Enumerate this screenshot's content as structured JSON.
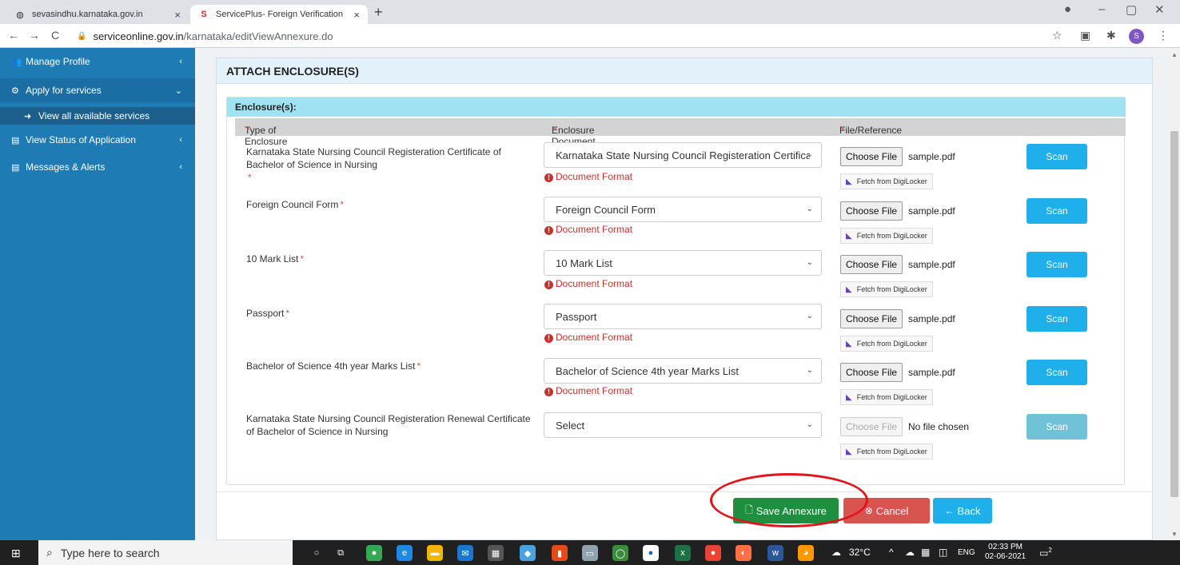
{
  "browser": {
    "tabs": [
      {
        "label": "sevasindhu.karnataka.gov.in"
      },
      {
        "label": "ServicePlus- Foreign Verification"
      }
    ],
    "url_host": "serviceonline.gov.in",
    "url_path": "/karnataka/editViewAnnexure.do",
    "profile_initial": "S"
  },
  "sidebar": {
    "items": [
      {
        "label": "Manage Profile"
      },
      {
        "label": "Apply for services"
      },
      {
        "label": "View all available services"
      },
      {
        "label": "View Status of Application"
      },
      {
        "label": "Messages & Alerts"
      }
    ]
  },
  "card": {
    "title": "ATTACH ENCLOSURE(S)",
    "panel_title": "Enclosure(s):",
    "columns": [
      "Type of Enclosure",
      "Enclosure Document",
      "File/Reference"
    ],
    "doc_format_label": "Document Format",
    "choose_file_label": "Choose File",
    "digilocker_label": "Fetch from DigiLocker",
    "scan_label": "Scan",
    "rows": [
      {
        "type": "Karnataka State Nursing Council Registeration Certificate of Bachelor of Science in Nursing",
        "document": "Karnataka State Nursing Council Registeration Certificate of Bachelor of Science in Nursing",
        "file": "sample.pdf"
      },
      {
        "type": "Foreign Council Form",
        "document": "Foreign Council Form",
        "file": "sample.pdf"
      },
      {
        "type": "10 Mark List",
        "document": "10 Mark List",
        "file": "sample.pdf"
      },
      {
        "type": "Passport",
        "document": "Passport",
        "file": "sample.pdf"
      },
      {
        "type": "Bachelor of Science 4th year Marks List",
        "document": "Bachelor of Science 4th year Marks List",
        "file": "sample.pdf"
      },
      {
        "type": "Karnataka State Nursing Council Registeration Renewal Certificate of Bachelor of Science in Nursing",
        "document": "Select",
        "file": "No file chosen"
      }
    ],
    "buttons": {
      "save": "Save Annexure",
      "cancel": "Cancel",
      "back": "Back"
    }
  },
  "taskbar": {
    "search_placeholder": "Type here to search",
    "weather": "32°C",
    "language": "ENG",
    "time": "02:33 PM",
    "date": "02-06-2021",
    "notifications": "2"
  },
  "colors": {
    "sidebar": "#1f7bb3",
    "panel_header": "#9fe3f3",
    "save": "#1e8f3e",
    "cancel": "#d9534f",
    "scan": "#1fb0ec",
    "highlight_ring": "#e3141c"
  }
}
